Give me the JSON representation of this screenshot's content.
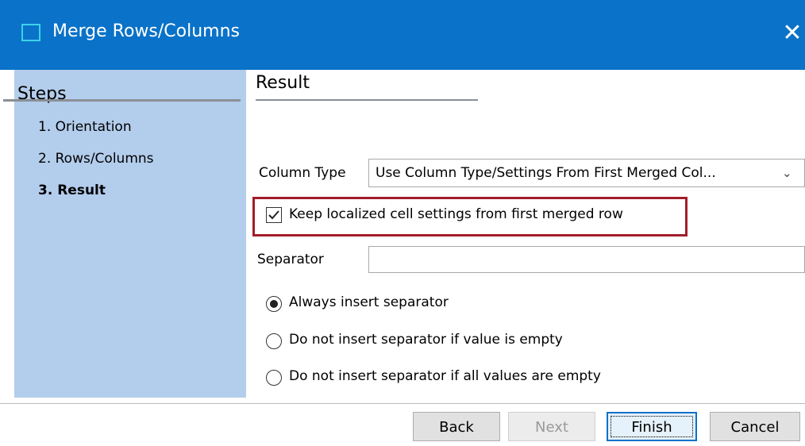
{
  "window": {
    "title": "Merge Rows/Columns",
    "close_glyph": "✕"
  },
  "steps": {
    "header": "Steps",
    "items": [
      {
        "label": "1. Orientation",
        "active": false
      },
      {
        "label": "2. Rows/Columns",
        "active": false
      },
      {
        "label": "3. Result",
        "active": true
      }
    ]
  },
  "result": {
    "header": "Result",
    "column_type": {
      "label": "Column Type",
      "value": "Use Column Type/Settings From First Merged Col..."
    },
    "keep_localized": {
      "label": "Keep localized cell settings from first merged row",
      "checked": true
    },
    "separator": {
      "label": "Separator",
      "value": ""
    },
    "radios": [
      {
        "label": "Always insert separator",
        "selected": true
      },
      {
        "label": "Do not insert separator if value is empty",
        "selected": false
      },
      {
        "label": "Do not insert separator if all values are empty",
        "selected": false
      }
    ]
  },
  "buttons": {
    "back": "Back",
    "next": "Next",
    "finish": "Finish",
    "cancel": "Cancel"
  },
  "colors": {
    "titlebar": "#0a72c8",
    "steps_panel": "#b3cdec",
    "highlight_border": "#a31d2a"
  },
  "icons": {
    "app": "window-icon",
    "close": "close-icon",
    "chevron": "chevron-down-icon",
    "check": "checkmark-icon"
  }
}
